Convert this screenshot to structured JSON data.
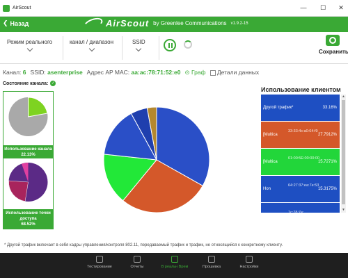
{
  "window": {
    "title": "AirScout",
    "min": "—",
    "max": "☐",
    "close": "✕"
  },
  "header": {
    "back_label": "Назад",
    "brand": "AirScout",
    "by": "by Greenlee Communications",
    "version": "v1.9.2-15"
  },
  "toolbar": {
    "mode_label": "Режим реального",
    "channel_label": "канал / диапазон",
    "ssid_label": "SSID",
    "save_label": "Сохранить"
  },
  "info": {
    "channel_label": "Канал:",
    "channel_value": "6",
    "ssid_label": "SSID:",
    "ssid_value": "asenterprise",
    "mac_label": "Адрес AP MAC:",
    "mac_value": "aa:ac:78:71:52:e0",
    "graph_label": "Граф",
    "details_label": "Детали данных"
  },
  "channel_state_label": "Состояние канала:",
  "cards": [
    {
      "label": "Использование канала",
      "value": "22.13%",
      "slice_frac": 0.2213
    },
    {
      "label": "Использование точки доступа",
      "value": "68.52%",
      "slice_frac": 0.6852
    }
  ],
  "usage": {
    "title": "Использование клиентом",
    "rows": [
      {
        "name": "Другой трафик*",
        "mac": "",
        "pct": "33.16%",
        "color": "#1e4fc2"
      },
      {
        "name": "[Multica",
        "mac": "33:33:4c:a0:64:f9",
        "pct": "27.7912%",
        "color": "#d4582a"
      },
      {
        "name": "[Multica",
        "mac": "01:00:5E:00:00:00",
        "pct": "15.7271%",
        "color": "#22d63a"
      },
      {
        "name": "Hon",
        "mac": "64:27:37:ea:7e:53",
        "pct": "15.3175%",
        "color": "#1e4fc2"
      },
      {
        "name": "Samsung",
        "mac": "7c:78:7e:",
        "pct": "5.1191%",
        "color": "#1e4fc2"
      }
    ]
  },
  "main_pie": {
    "slices": [
      {
        "value": 33.16,
        "color": "#2a4fc7"
      },
      {
        "value": 27.7912,
        "color": "#d4582a"
      },
      {
        "value": 15.7271,
        "color": "#22e838"
      },
      {
        "value": 15.3175,
        "color": "#2a4fc7"
      },
      {
        "value": 5.1191,
        "color": "#1f3fae"
      },
      {
        "value": 2.8651,
        "color": "#b5882e"
      }
    ]
  },
  "footnote": "* Другой трафик включает в себя кадры управления/контроля 802.11, передаваемый трафик и трафик, не относящийся к конкретному клиенту.",
  "nav": [
    {
      "label": "Тестирование",
      "active": false
    },
    {
      "label": "Отчеты",
      "active": false
    },
    {
      "label": "В реальн Врем",
      "active": true
    },
    {
      "label": "Прошивка",
      "active": false
    },
    {
      "label": "Настройки",
      "active": false
    }
  ]
}
